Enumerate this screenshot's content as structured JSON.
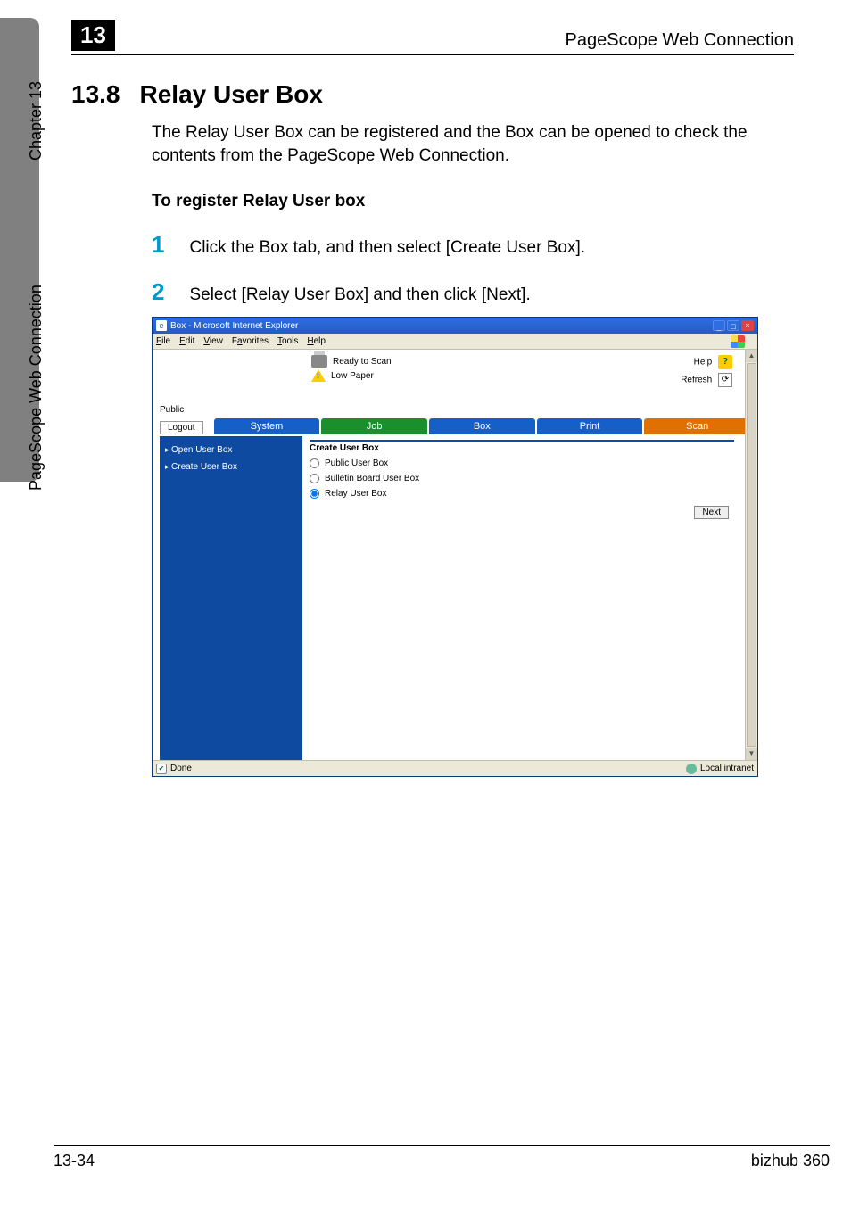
{
  "side": {
    "chapter": "Chapter 13",
    "label": "PageScope Web Connection"
  },
  "header": {
    "chapter_badge": "13",
    "title": "PageScope Web Connection"
  },
  "section": {
    "number": "13.8",
    "title": "Relay User Box",
    "intro": "The Relay User Box can be registered and the Box can be opened to check the contents from the PageScope Web Connection.",
    "subhead": "To register Relay User box"
  },
  "steps": [
    {
      "num": "1",
      "text": "Click the Box tab, and then select [Create User Box]."
    },
    {
      "num": "2",
      "text": "Select [Relay User Box] and then click [Next]."
    }
  ],
  "ie": {
    "title": "Box - Microsoft Internet Explorer",
    "menu": [
      "File",
      "Edit",
      "View",
      "Favorites",
      "Tools",
      "Help"
    ],
    "status": {
      "ready": "Ready to Scan",
      "low": "Low Paper",
      "help": "Help",
      "refresh": "Refresh"
    },
    "public_label": "Public",
    "logout": "Logout",
    "tabs": {
      "system": "System",
      "job": "Job",
      "box": "Box",
      "print": "Print",
      "scan": "Scan"
    },
    "sidebar": {
      "open": "Open User Box",
      "create": "Create User Box"
    },
    "form": {
      "title": "Create User Box",
      "options": [
        {
          "label": "Public User Box",
          "checked": false
        },
        {
          "label": "Bulletin Board User Box",
          "checked": false
        },
        {
          "label": "Relay User Box",
          "checked": true
        }
      ],
      "next": "Next"
    },
    "statusbar": {
      "done": "Done",
      "zone": "Local intranet"
    }
  },
  "footer": {
    "left": "13-34",
    "right": "bizhub 360"
  }
}
